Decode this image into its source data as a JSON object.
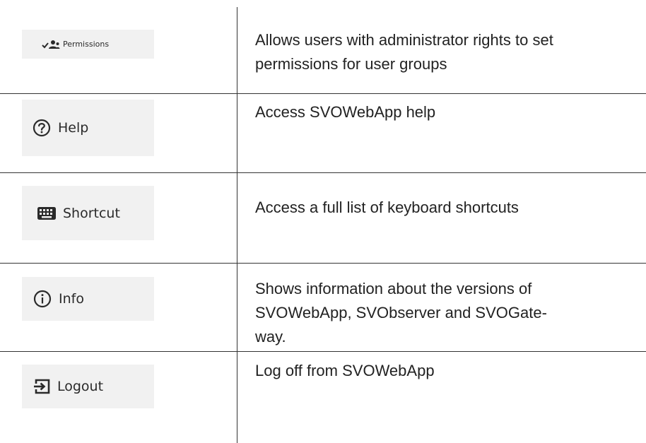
{
  "rows": [
    {
      "button_label": "Permissions",
      "icon": "user-group-check-icon",
      "description": "Allows users with administrator rights to set\npermissions for user groups"
    },
    {
      "button_label": "Help",
      "icon": "question-circle-icon",
      "description": "Access SVOWebApp help"
    },
    {
      "button_label": "Shortcut",
      "icon": "keyboard-icon",
      "description": "Access a full list of keyboard shortcuts"
    },
    {
      "button_label": "Info",
      "icon": "info-circle-icon",
      "description": "Shows information about the versions of\nSVOWebApp, SVObserver and SVOGate-\nway."
    },
    {
      "button_label": "Logout",
      "icon": "logout-icon",
      "description": "Log off from SVOWebApp"
    }
  ],
  "colors": {
    "button_background": "#f1f1f1",
    "rule": "#333333",
    "text": "#222222"
  }
}
